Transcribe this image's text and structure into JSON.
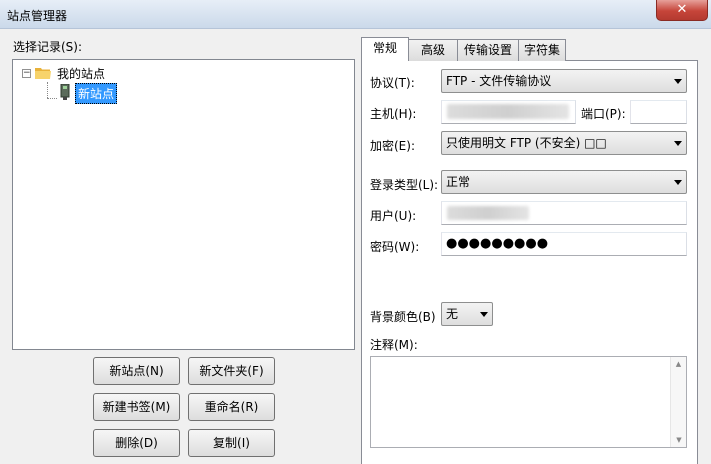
{
  "window": {
    "title": "站点管理器",
    "close_glyph": "✕"
  },
  "left": {
    "select_label": "选择记录(S):",
    "tree": {
      "expander_glyph": "−",
      "root_label": "我的站点",
      "site_label": "新站点"
    },
    "buttons": {
      "new_site": "新站点(N)",
      "new_folder": "新文件夹(F)",
      "new_bookmark": "新建书签(M)",
      "rename": "重命名(R)",
      "delete": "删除(D)",
      "copy": "复制(I)"
    }
  },
  "tabs": [
    "常规",
    "高级",
    "传输设置",
    "字符集"
  ],
  "general": {
    "protocol_label": "协议(T):",
    "protocol_value": "FTP - 文件传输协议",
    "host_label": "主机(H):",
    "host_value": "",
    "port_label": "端口(P):",
    "port_value": "",
    "encryption_label": "加密(E):",
    "encryption_value": "只使用明文 FTP (不安全) □□",
    "logon_type_label": "登录类型(L):",
    "logon_type_value": "正常",
    "user_label": "用户(U):",
    "user_value": "",
    "password_label": "密码(W):",
    "password_value": "●●●●●●●●●",
    "bg_color_label": "背景颜色(B)",
    "bg_color_value": "无",
    "comment_label": "注释(M):",
    "comment_value": ""
  },
  "colors": {
    "selection": "#3399ff",
    "close": "#c6453a"
  }
}
